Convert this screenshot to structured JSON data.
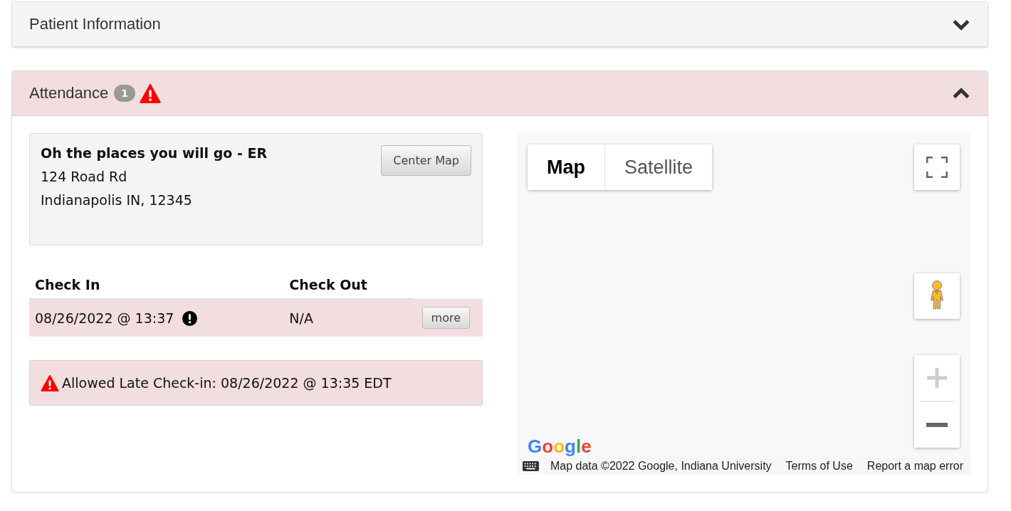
{
  "panels": [
    {
      "title": "Patient Information",
      "expanded": false,
      "alert": false
    },
    {
      "title": "Attendance",
      "expanded": true,
      "alert": true,
      "count": "1"
    }
  ],
  "location": {
    "name": "Oh the places you will go - ER",
    "address": [
      "124 Road Rd",
      "Indianapolis IN, 12345"
    ],
    "button": "Center Map"
  },
  "attendance_table": {
    "columns": [
      "Check In",
      "Check Out"
    ],
    "rows": [
      {
        "check_in": "08/26/2022 @ 13:37",
        "flagged": true,
        "check_out": "N/A",
        "button": "more"
      }
    ]
  },
  "late_notice": "Allowed Late Check-in: 08/26/2022 @ 13:35 EDT",
  "map": {
    "types": [
      {
        "label": "Map",
        "selected": true
      },
      {
        "label": "Satellite",
        "selected": false
      }
    ],
    "logo": "Google",
    "attribution": "Map data ©2022 Google, Indiana University",
    "links": [
      "Terms of Use",
      "Report a map error"
    ]
  }
}
